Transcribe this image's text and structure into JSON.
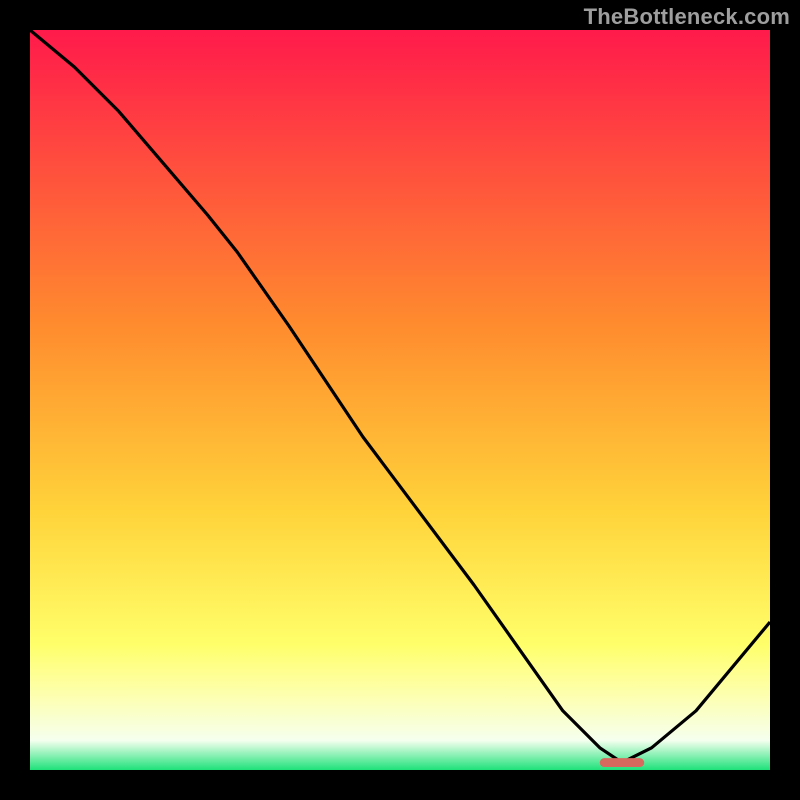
{
  "watermark": "TheBottleneck.com",
  "chart_data": {
    "type": "line",
    "title": "",
    "xlabel": "",
    "ylabel": "",
    "xlim": [
      0,
      100
    ],
    "ylim": [
      0,
      100
    ],
    "grid": false,
    "background_gradient": {
      "stops": [
        {
          "pos": 0.0,
          "color": "#ff1a4b"
        },
        {
          "pos": 0.4,
          "color": "#ff8c2e"
        },
        {
          "pos": 0.65,
          "color": "#ffd33a"
        },
        {
          "pos": 0.83,
          "color": "#ffff6a"
        },
        {
          "pos": 0.9,
          "color": "#fdffb0"
        },
        {
          "pos": 0.96,
          "color": "#f5ffee"
        },
        {
          "pos": 1.0,
          "color": "#1ee27a"
        }
      ]
    },
    "series": [
      {
        "name": "bottleneck-curve",
        "type": "line",
        "color": "#000000",
        "x": [
          0,
          6,
          12,
          18,
          24,
          28,
          35,
          45,
          60,
          72,
          77,
          80,
          84,
          90,
          100
        ],
        "y": [
          100,
          95,
          89,
          82,
          75,
          70,
          60,
          45,
          25,
          8,
          3,
          1,
          3,
          8,
          20
        ]
      },
      {
        "name": "optimal-marker",
        "type": "marker",
        "color": "#d76a5e",
        "x": [
          80
        ],
        "y": [
          1
        ],
        "width_pct": 6
      }
    ]
  }
}
